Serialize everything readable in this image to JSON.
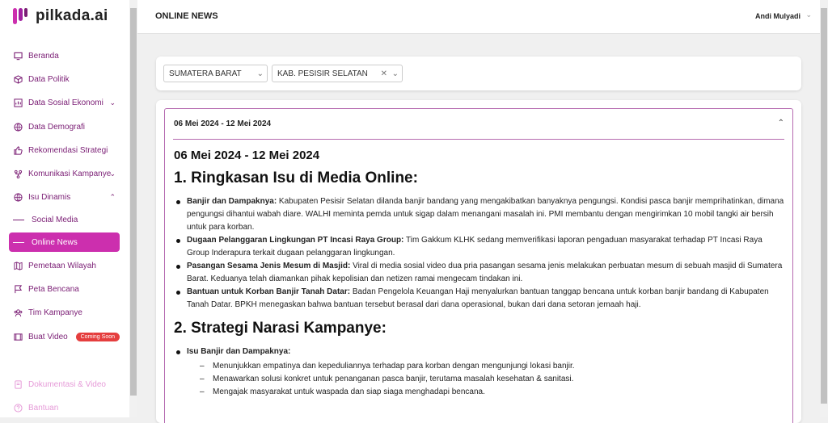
{
  "app": {
    "name": "pilkada.ai"
  },
  "sidebar": {
    "items": [
      {
        "label": "Beranda",
        "icon": "monitor-icon"
      },
      {
        "label": "Data Politik",
        "icon": "cube-icon"
      },
      {
        "label": "Data Sosial Ekonomi",
        "icon": "chart-icon"
      },
      {
        "label": "Data Demografi",
        "icon": "globe-icon"
      },
      {
        "label": "Rekomendasi Strategi",
        "icon": "thumbs-up-icon"
      },
      {
        "label": "Komunikasi Kampanye",
        "icon": "tree-icon"
      },
      {
        "label": "Isu Dinamis",
        "icon": "globe-icon"
      },
      {
        "label": "Social Media"
      },
      {
        "label": "Online News"
      },
      {
        "label": "Pemetaan Wilayah",
        "icon": "map-icon"
      },
      {
        "label": "Peta Bencana",
        "icon": "flag-icon"
      },
      {
        "label": "Tim Kampanye",
        "icon": "users-icon"
      },
      {
        "label": "Buat Video",
        "icon": "film-icon",
        "badge": "Coming Soon"
      }
    ],
    "bottom": [
      {
        "label": "Dokumentasi & Video",
        "icon": "book-icon"
      },
      {
        "label": "Bantuan",
        "icon": "help-icon"
      }
    ]
  },
  "header": {
    "title": "ONLINE NEWS",
    "user": "Andi Mulyadi"
  },
  "filters": {
    "province": "SUMATERA BARAT",
    "regency": "KAB. PESISIR SELATAN"
  },
  "accordion": {
    "header": "06 Mei 2024 - 12 Mei 2024",
    "subtitle": "06 Mei 2024 - 12 Mei 2024",
    "section1_title": "1. Ringkasan Isu di Media Online:",
    "section1_items": [
      {
        "bold": "Banjir dan Dampaknya:",
        "text": " Kabupaten Pesisir Selatan dilanda banjir bandang yang mengakibatkan banyaknya pengungsi. Kondisi pasca banjir memprihatinkan, dimana pengungsi dihantui wabah diare. WALHI meminta pemda untuk sigap dalam menangani masalah ini. PMI membantu dengan mengirimkan 10 mobil tangki air bersih untuk para korban."
      },
      {
        "bold": "Dugaan Pelanggaran Lingkungan PT Incasi Raya Group:",
        "text": " Tim Gakkum KLHK sedang memverifikasi laporan pengaduan masyarakat terhadap PT Incasi Raya Group Inderapura terkait dugaan pelanggaran lingkungan."
      },
      {
        "bold": "Pasangan Sesama Jenis Mesum di Masjid:",
        "text": " Viral di media sosial video dua pria pasangan sesama jenis melakukan perbuatan mesum di sebuah masjid di Sumatera Barat. Keduanya telah diamankan pihak kepolisian dan netizen ramai mengecam tindakan ini."
      },
      {
        "bold": "Bantuan untuk Korban Banjir Tanah Datar:",
        "text": " Badan Pengelola Keuangan Haji menyalurkan bantuan tanggap bencana untuk korban banjir bandang di Kabupaten Tanah Datar. BPKH menegaskan bahwa bantuan tersebut berasal dari dana operasional, bukan dari dana setoran jemaah haji."
      }
    ],
    "section2_title": "2. Strategi Narasi Kampanye:",
    "section2_item_bold": "Isu Banjir dan Dampaknya:",
    "section2_subitems": [
      "Menunjukkan empatinya dan kepeduliannya terhadap para korban dengan mengunjungi lokasi banjir.",
      "Menawarkan solusi konkret untuk penanganan pasca banjir, terutama masalah kesehatan & sanitasi.",
      "Mengajak masyarakat untuk waspada dan siap siaga menghadapi bencana."
    ]
  },
  "colors": {
    "accent": "#cc2fae",
    "nav_text": "#7a1d74",
    "badge": "#e53e3e"
  }
}
